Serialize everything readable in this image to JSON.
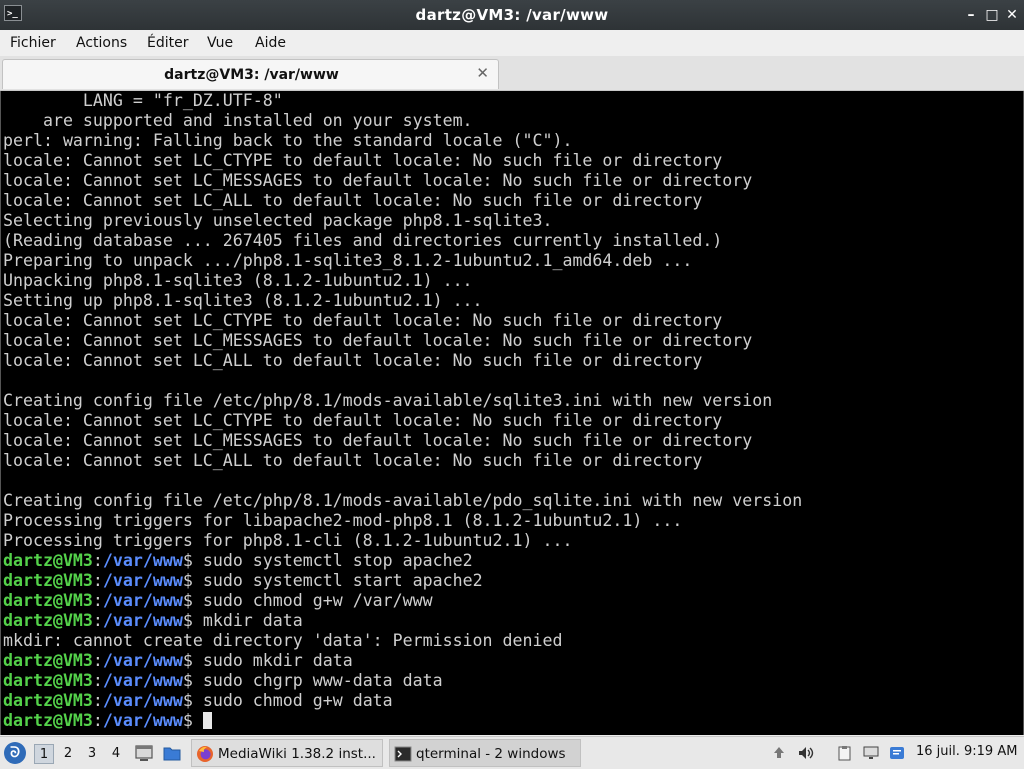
{
  "window": {
    "title": "dartz@VM3: /var/www",
    "minimize": "–",
    "maximize": "□",
    "close": "✕"
  },
  "menubar": {
    "items": [
      "Fichier",
      "Actions",
      "Éditer",
      "Vue",
      "Aide"
    ]
  },
  "tab": {
    "label": "dartz@VM3: /var/www",
    "close": "✕"
  },
  "terminal": {
    "prompt_user": "dartz@VM3",
    "prompt_sep": ":",
    "prompt_path": "/var/www",
    "prompt_end": "$ ",
    "lines": [
      {
        "text": "        LANG = \"fr_DZ.UTF-8\""
      },
      {
        "text": "    are supported and installed on your system."
      },
      {
        "text": "perl: warning: Falling back to the standard locale (\"C\")."
      },
      {
        "text": "locale: Cannot set LC_CTYPE to default locale: No such file or directory"
      },
      {
        "text": "locale: Cannot set LC_MESSAGES to default locale: No such file or directory"
      },
      {
        "text": "locale: Cannot set LC_ALL to default locale: No such file or directory"
      },
      {
        "text": "Selecting previously unselected package php8.1-sqlite3."
      },
      {
        "text": "(Reading database ... 267405 files and directories currently installed.)"
      },
      {
        "text": "Preparing to unpack .../php8.1-sqlite3_8.1.2-1ubuntu2.1_amd64.deb ..."
      },
      {
        "text": "Unpacking php8.1-sqlite3 (8.1.2-1ubuntu2.1) ..."
      },
      {
        "text": "Setting up php8.1-sqlite3 (8.1.2-1ubuntu2.1) ..."
      },
      {
        "text": "locale: Cannot set LC_CTYPE to default locale: No such file or directory"
      },
      {
        "text": "locale: Cannot set LC_MESSAGES to default locale: No such file or directory"
      },
      {
        "text": "locale: Cannot set LC_ALL to default locale: No such file or directory"
      },
      {
        "text": ""
      },
      {
        "text": "Creating config file /etc/php/8.1/mods-available/sqlite3.ini with new version"
      },
      {
        "text": "locale: Cannot set LC_CTYPE to default locale: No such file or directory"
      },
      {
        "text": "locale: Cannot set LC_MESSAGES to default locale: No such file or directory"
      },
      {
        "text": "locale: Cannot set LC_ALL to default locale: No such file or directory"
      },
      {
        "text": ""
      },
      {
        "text": "Creating config file /etc/php/8.1/mods-available/pdo_sqlite.ini with new version"
      },
      {
        "text": "Processing triggers for libapache2-mod-php8.1 (8.1.2-1ubuntu2.1) ..."
      },
      {
        "text": "Processing triggers for php8.1-cli (8.1.2-1ubuntu2.1) ..."
      },
      {
        "prompt": true,
        "text": "sudo systemctl stop apache2"
      },
      {
        "prompt": true,
        "text": "sudo systemctl start apache2"
      },
      {
        "prompt": true,
        "text": "sudo chmod g+w /var/www"
      },
      {
        "prompt": true,
        "text": "mkdir data"
      },
      {
        "text": "mkdir: cannot create directory 'data': Permission denied"
      },
      {
        "prompt": true,
        "text": "sudo mkdir data"
      },
      {
        "prompt": true,
        "text": "sudo chgrp www-data data"
      },
      {
        "prompt": true,
        "text": "sudo chmod g+w data"
      },
      {
        "prompt": true,
        "text": "",
        "cursor": true
      }
    ]
  },
  "taskbar": {
    "workspaces": [
      "1",
      "2",
      "3",
      "4"
    ],
    "active_workspace": "1",
    "tasks": [
      {
        "label": "MediaWiki 1.38.2 inst...",
        "icon": "firefox-icon"
      },
      {
        "label": "qterminal - 2 windows",
        "icon": "terminal-icon"
      }
    ],
    "clock": "16 juil. 9:19 AM"
  },
  "colors": {
    "prompt_user": "#54d24a",
    "prompt_path": "#5a8dff",
    "terminal_bg": "#000000",
    "terminal_fg": "#cfcfcf"
  }
}
